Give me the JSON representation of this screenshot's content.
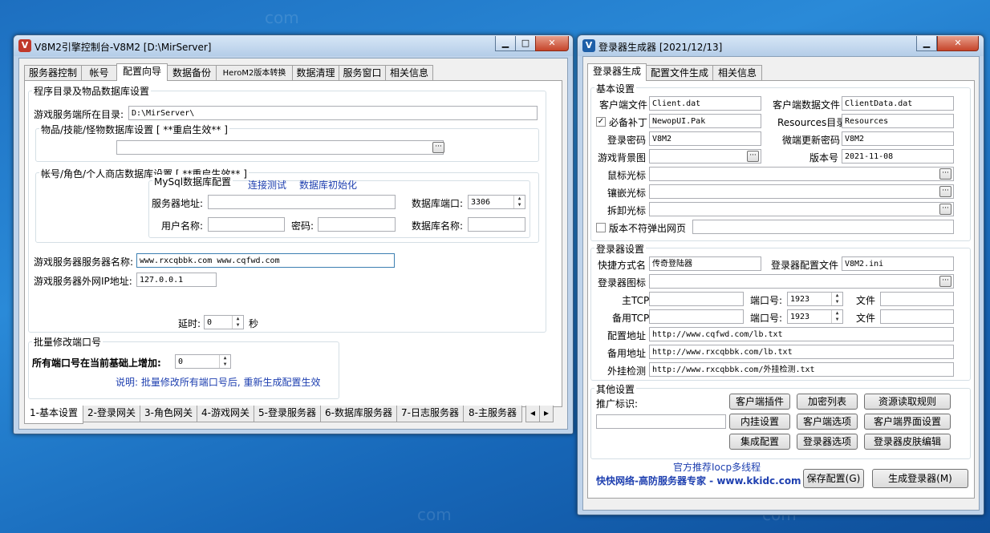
{
  "left_window": {
    "title": "V8M2引擎控制台-V8M2 [D:\\MirServer]",
    "icon": "V",
    "controls": [
      "minimize-icon",
      "maximize-icon",
      "close-icon"
    ],
    "top_tabs": [
      "服务器控制",
      "帐号",
      "配置向导",
      "数据备份",
      "HeroM2版本转换",
      "数据清理",
      "服务窗口",
      "相关信息"
    ],
    "group_main": "程序目录及物品数据库设置",
    "server_dir_label": "游戏服务端所在目录:",
    "server_dir_value": "D:\\MirServer\\",
    "item_db_label": "物品/技能/怪物数据库设置 [ **重启生效** ]",
    "item_db_value": "",
    "account_db_label": "帐号/角色/个人商店数据库设置  [ **重启生效** ]",
    "mysql_label": "MySql数据库配置",
    "test_connection": "连接测试",
    "db_init": "数据库初始化",
    "server_addr_label": "服务器地址:",
    "server_addr_value": "",
    "db_port_label": "数据库端口:",
    "db_port_value": "3306",
    "username_label": "用户名称:",
    "username_value": "",
    "password_label": "密码:",
    "password_value": "",
    "db_name_label": "数据库名称:",
    "db_name_value": "",
    "server_name_label": "游戏服务器服务器名称:",
    "server_name_value": "www.rxcqbbk.com www.cqfwd.com",
    "ip_label": "游戏服务器外网IP地址:",
    "ip_value": "127.0.0.1",
    "delay_label": "延时:",
    "delay_value": "0",
    "delay_unit": "秒",
    "batch_group": "批量修改端口号",
    "batch_label": "所有端口号在当前基础上增加:",
    "batch_value": "0",
    "batch_note": "说明: 批量修改所有端口号后, 重新生成配置生效",
    "bottom_tabs": [
      "1-基本设置",
      "2-登录网关",
      "3-角色网关",
      "4-游戏网关",
      "5-登录服务器",
      "6-数据库服务器",
      "7-日志服务器",
      "8-主服务器"
    ]
  },
  "right_window": {
    "title": "登录器生成器 [2021/12/13]",
    "icon": "V",
    "tabs": [
      "登录器生成",
      "配置文件生成",
      "相关信息"
    ],
    "basic_group": "基本设置",
    "client_file_label": "客户端文件",
    "client_file_value": "Client.dat",
    "client_data_label": "客户端数据文件",
    "client_data_value": "ClientData.dat",
    "patch_label": "必备补丁",
    "patch_checked": true,
    "patch_value": "NewopUI.Pak",
    "resources_label": "Resources目录",
    "resources_value": "Resources",
    "login_pwd_label": "登录密码",
    "login_pwd_value": "V8M2",
    "update_pwd_label": "微端更新密码",
    "update_pwd_value": "V8M2",
    "bg_label": "游戏背景图",
    "version_label": "版本号",
    "version_value": "2021-11-08",
    "mouse_cursor_label": "鼠标光标",
    "inlay_cursor_label": "镶嵌光标",
    "remove_cursor_label": "拆卸光标",
    "version_popup_label": "版本不符弹出网页",
    "launcher_group": "登录器设置",
    "shortcut_label": "快捷方式名",
    "shortcut_value": "传奇登陆器",
    "config_file_label": "登录器配置文件",
    "config_file_value": "V8M2.ini",
    "launcher_icon_label": "登录器图标",
    "main_tcp_label": "主TCP",
    "port_label": "端口号:",
    "main_port_value": "1923",
    "file_label": "文件",
    "backup_tcp_label": "备用TCP",
    "backup_port_value": "1923",
    "config_url_label": "配置地址",
    "config_url_value": "http://www.cqfwd.com/lb.txt",
    "backup_url_label": "备用地址",
    "backup_url_value": "http://www.rxcqbbk.com/lb.txt",
    "cheat_label": "外挂检测",
    "cheat_value": "http://www.rxcqbbk.com/外挂检测.txt",
    "other_group": "其他设置",
    "promo_label": "推广标识:",
    "buttons_row1": [
      "客户端插件",
      "加密列表",
      "资源读取规则"
    ],
    "buttons_row2": [
      "内挂设置",
      "客户端选项",
      "客户端界面设置"
    ],
    "buttons_row3": [
      "集成配置",
      "登录器选项",
      "登录器皮肤编辑"
    ],
    "recommend": "官方推荐Iocp多线程",
    "ad_text": "快快网络-高防服务器专家 - www.kkidc.com",
    "save_button": "保存配置(G)",
    "generate_button": "生成登录器(M)"
  },
  "colors": {
    "desktop": "#1d6fc0",
    "link_blue": "#1f40b0",
    "left_icon": "#c0392b",
    "right_icon": "#1e5fa8"
  }
}
